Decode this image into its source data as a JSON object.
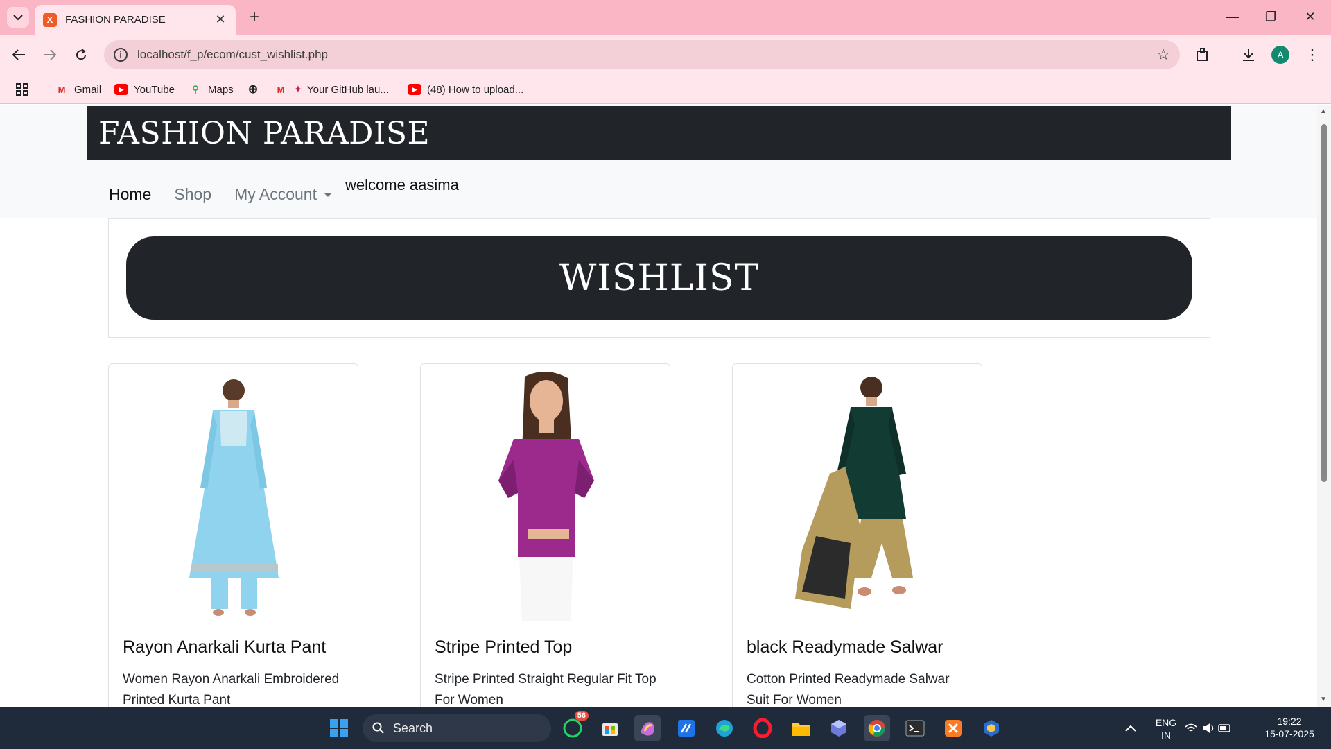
{
  "browser": {
    "tab_title": "FASHION PARADISE",
    "url": "localhost/f_p/ecom/cust_wishlist.php",
    "profile_initial": "A",
    "bookmarks": [
      {
        "label": "Gmail",
        "icon": "gmail-icon"
      },
      {
        "label": "YouTube",
        "icon": "youtube-icon"
      },
      {
        "label": "Maps",
        "icon": "maps-icon"
      },
      {
        "label": "",
        "icon": "globe-icon"
      },
      {
        "label": "Your GitHub lau...",
        "icon": "github-icon"
      },
      {
        "label": "(48) How to upload...",
        "icon": "youtube-icon"
      }
    ]
  },
  "site": {
    "brand": "FASHION PARADISE",
    "nav": {
      "home": "Home",
      "shop": "Shop",
      "account": "My Account",
      "welcome": "welcome aasima"
    },
    "banner_title": "WISHLIST"
  },
  "products": [
    {
      "title": "Rayon Anarkali Kurta Pant",
      "description": "Women Rayon Anarkali Embroidered Printed Kurta Pant",
      "outfit_color": "#8fd3ee"
    },
    {
      "title": "Stripe Printed Top",
      "description": "Stripe Printed Straight Regular Fit Top For Women",
      "outfit_color": "#9b2a8c"
    },
    {
      "title": "black Readymade Salwar",
      "description": "Cotton Printed Readymade Salwar Suit For Women",
      "outfit_color": "#123c33"
    }
  ],
  "taskbar": {
    "search_label": "Search",
    "whatsapp_badge": "56",
    "lang": "ENG",
    "region": "IN",
    "time": "19:22",
    "date": "15-07-2025"
  },
  "colors": {
    "chrome_tabbar": "#fbb6c6",
    "chrome_toolbar": "#ffe6ec",
    "brand_dark": "#212529"
  }
}
